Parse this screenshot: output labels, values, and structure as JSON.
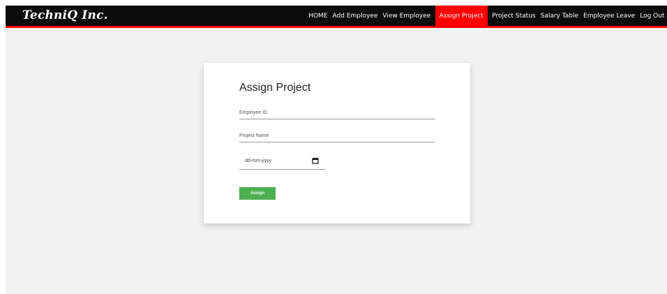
{
  "brand": "TechniQ Inc.",
  "nav": {
    "items": [
      {
        "label": "HOME"
      },
      {
        "label": "Add Employee"
      },
      {
        "label": "View Employee"
      },
      {
        "label": "Assign Project"
      },
      {
        "label": "Project Status"
      },
      {
        "label": "Salary Table"
      },
      {
        "label": "Employee Leave"
      },
      {
        "label": "Log Out"
      }
    ],
    "active": "Assign Project"
  },
  "form": {
    "title": "Assign Project",
    "employee_id_placeholder": "Employee ID",
    "project_name_placeholder": "Project Name",
    "date_placeholder": "dd-mm-yyyy",
    "submit_label": "Assign"
  },
  "colors": {
    "topbar": "#0c0c0c",
    "accent": "#ff0000",
    "button": "#4caf50",
    "background": "#f2f2f2"
  }
}
